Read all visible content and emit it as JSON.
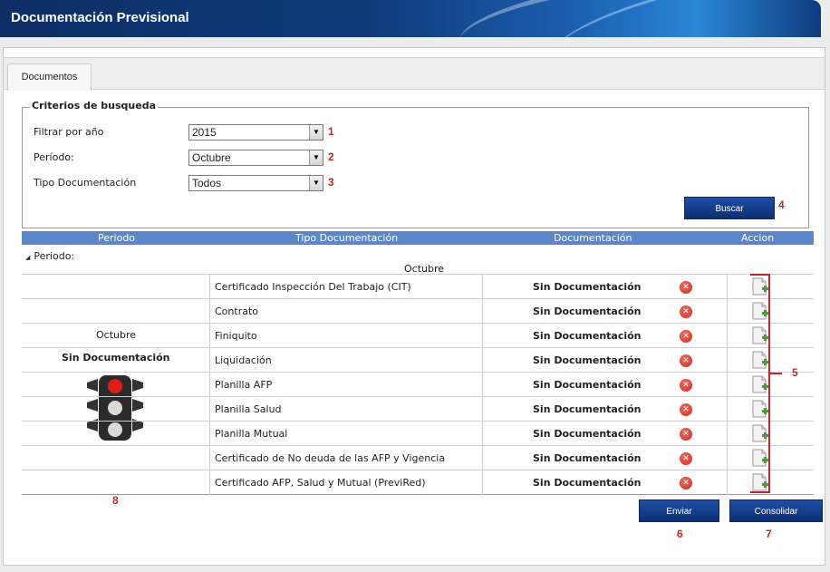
{
  "header": {
    "title": "Documentación Previsional"
  },
  "tabs": [
    {
      "label": "Documentos"
    }
  ],
  "criteria": {
    "legend": "Criterios de busqueda",
    "fields": [
      {
        "label": "Filtrar por año",
        "value": "2015",
        "marker": "1"
      },
      {
        "label": "Período:",
        "value": "Octubre",
        "marker": "2"
      },
      {
        "label": "Tipo Documentación",
        "value": "Todos",
        "marker": "3"
      }
    ],
    "search_button": "Buscar",
    "search_marker": "4"
  },
  "table": {
    "columns": [
      "Periodo",
      "Tipo Documentación",
      "Documentación",
      "Accion"
    ],
    "group_label": "Periodo:",
    "group_caption": "Octubre",
    "left_period": "Octubre",
    "left_status": "Sin Documentación",
    "traffic_marker": "8",
    "rows": [
      {
        "tipo": "Certificado Inspección Del Trabajo (CIT)",
        "status": "Sin Documentación"
      },
      {
        "tipo": "Contrato",
        "status": "Sin Documentación"
      },
      {
        "tipo": "Finiquito",
        "status": "Sin Documentación"
      },
      {
        "tipo": "Liquidación",
        "status": "Sin Documentación"
      },
      {
        "tipo": "Planilla AFP",
        "status": "Sin Documentación"
      },
      {
        "tipo": "Planilla Salud",
        "status": "Sin Documentación"
      },
      {
        "tipo": "Planilla Mutual",
        "status": "Sin Documentación"
      },
      {
        "tipo": "Certificado de No deuda de las AFP y Vigencia",
        "status": "Sin Documentación"
      },
      {
        "tipo": "Certificado AFP, Salud y Mutual (PreviRed)",
        "status": "Sin Documentación"
      }
    ],
    "actions_marker": "5"
  },
  "footer": {
    "enviar_label": "Enviar",
    "enviar_marker": "6",
    "consolidar_label": "Consolidar",
    "consolidar_marker": "7"
  },
  "icons": {
    "status": "x-circle-icon",
    "action": "document-add-icon",
    "traffic": "traffic-light-icon"
  },
  "colors": {
    "header_bg": "#0f3a7a",
    "table_header": "#5b87c9",
    "button_bg": "#173f8c",
    "marker": "#c0282b",
    "error_icon": "#d42a1e"
  }
}
